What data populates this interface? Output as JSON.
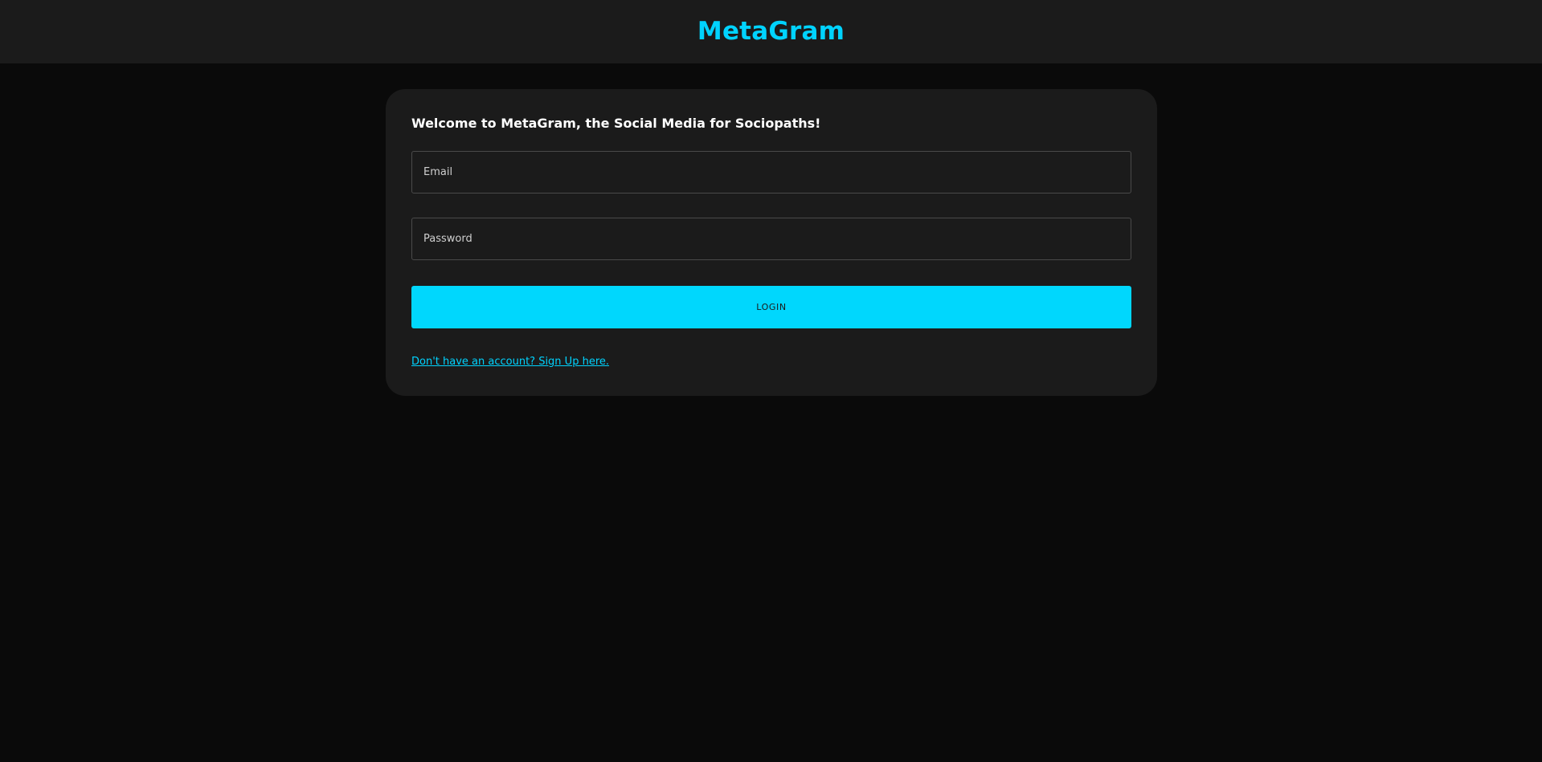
{
  "header": {
    "brand": "MetaGram"
  },
  "login_card": {
    "welcome": "Welcome to MetaGram, the Social Media for Sociopaths!",
    "email": {
      "value": "",
      "placeholder": "Email"
    },
    "password": {
      "value": "",
      "placeholder": "Password"
    },
    "login_label": "LOGIN",
    "signup_link": "Don't have an account? Sign Up here."
  },
  "colors": {
    "accent": "#00d3ff",
    "header_bg": "#1b1b1b",
    "page_bg": "#0a0a0a",
    "card_bg": "#1b1b1b"
  }
}
